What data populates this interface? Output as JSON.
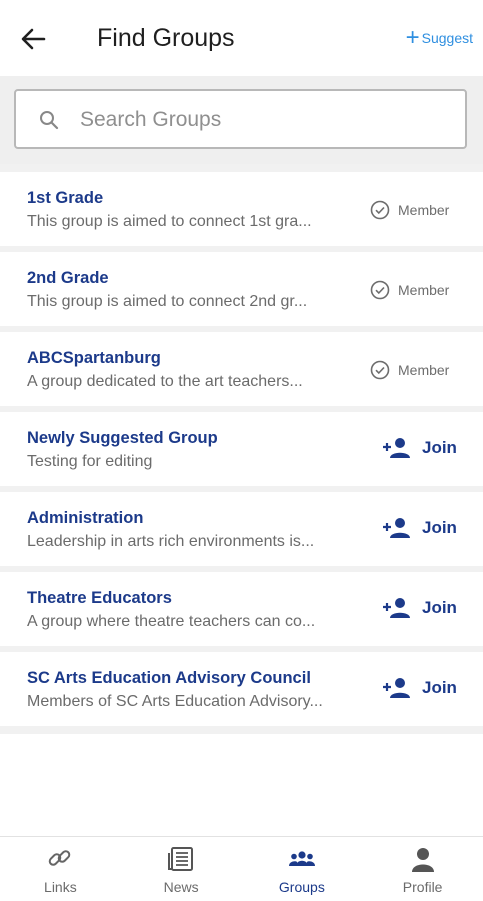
{
  "header": {
    "title": "Find Groups",
    "suggest_label": "Suggest"
  },
  "search": {
    "placeholder": "Search Groups",
    "value": ""
  },
  "groups": [
    {
      "name": "1st Grade",
      "description": "This group is aimed to connect 1st gra...",
      "status": "Member"
    },
    {
      "name": "2nd Grade",
      "description": "This group is aimed to connect 2nd gr...",
      "status": "Member"
    },
    {
      "name": "ABCSpartanburg",
      "description": "A group dedicated to the art teachers...",
      "status": "Member"
    },
    {
      "name": "Newly Suggested Group",
      "description": "Testing for editing",
      "status": "Join"
    },
    {
      "name": "Administration",
      "description": "Leadership in arts rich environments is...",
      "status": "Join"
    },
    {
      "name": "Theatre Educators",
      "description": "A group where theatre teachers can co...",
      "status": "Join"
    },
    {
      "name": "SC Arts Education Advisory Council",
      "description": "Members of SC Arts Education Advisory...",
      "status": "Join"
    }
  ],
  "nav": {
    "items": [
      {
        "label": "Links",
        "icon": "link-icon"
      },
      {
        "label": "News",
        "icon": "news-icon"
      },
      {
        "label": "Groups",
        "icon": "groups-icon",
        "active": true
      },
      {
        "label": "Profile",
        "icon": "profile-icon"
      }
    ]
  },
  "colors": {
    "accent": "#1c3a8a",
    "suggest": "#2f8fe0",
    "muted_text": "#6b6b6b"
  }
}
